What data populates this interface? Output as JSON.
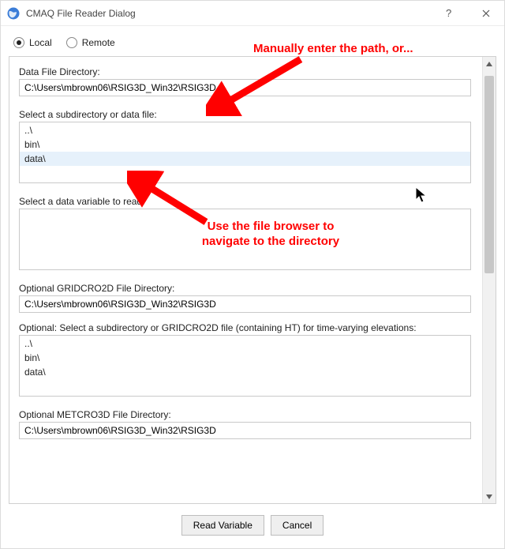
{
  "title": "CMAQ File Reader Dialog",
  "source": {
    "local_label": "Local",
    "remote_label": "Remote",
    "selected": "local"
  },
  "labels": {
    "data_dir": "Data File Directory:",
    "select_sub": "Select a subdirectory or data file:",
    "select_var": "Select a data variable to read:",
    "grid_dir": "Optional GRIDCRO2D File Directory:",
    "grid_sub": "Optional: Select a subdirectory or GRIDCRO2D file (containing HT) for time-varying elevations:",
    "met_dir": "Optional METCRO3D File Directory:"
  },
  "values": {
    "data_dir": "C:\\Users\\mbrown06\\RSIG3D_Win32\\RSIG3D",
    "grid_dir": "C:\\Users\\mbrown06\\RSIG3D_Win32\\RSIG3D",
    "met_dir": "C:\\Users\\mbrown06\\RSIG3D_Win32\\RSIG3D"
  },
  "file_list_a": [
    "..\\",
    "bin\\",
    "data\\"
  ],
  "file_list_b": [
    "..\\",
    "bin\\",
    "data\\"
  ],
  "var_list": [],
  "selected_index_a": 2,
  "buttons": {
    "read": "Read Variable",
    "cancel": "Cancel"
  },
  "annotations": {
    "top": "Manually enter the path, or...",
    "middle": "Use the file browser to\nnavigate to the directory"
  }
}
